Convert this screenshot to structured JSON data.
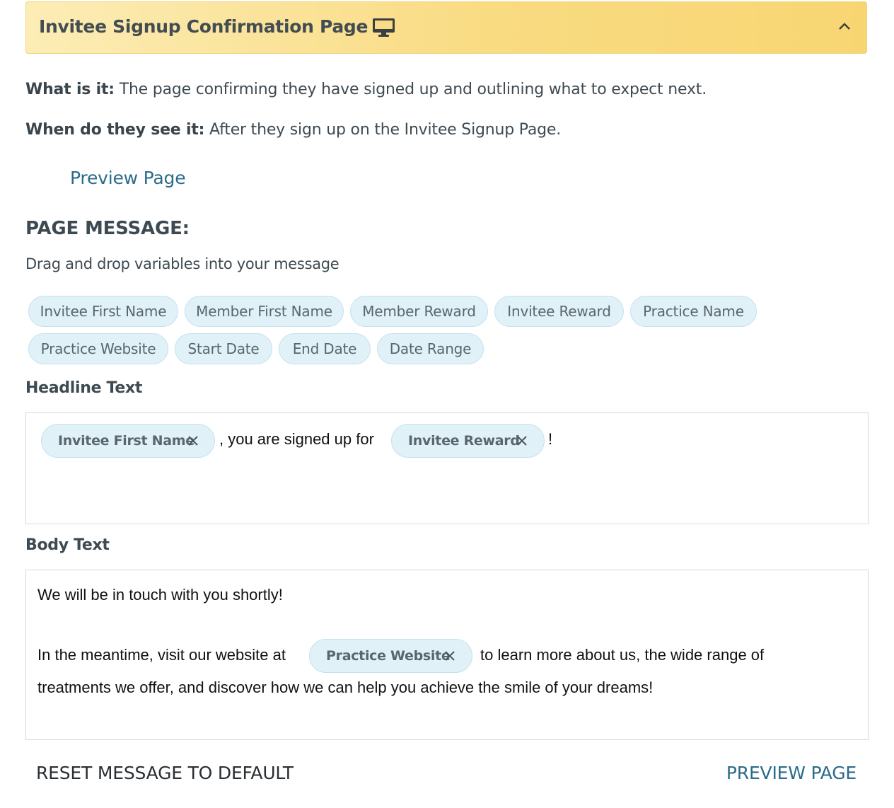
{
  "header": {
    "title": "Invitee Signup Confirmation Page",
    "device_icon": "desktop-monitor-icon",
    "collapse_icon": "chevron-up-icon"
  },
  "info": {
    "what_label": "What is it:",
    "what_text": " The page confirming they have signed up and outlining what to expect next.",
    "when_label": "When do they see it:",
    "when_text": " After they sign up on the Invitee Signup Page."
  },
  "preview_link": "Preview Page",
  "page_message": {
    "title": "PAGE MESSAGE:",
    "subtitle": "Drag and drop variables into your message",
    "variables": [
      "Invitee First Name",
      "Member First Name",
      "Member Reward",
      "Invitee Reward",
      "Practice Name",
      "Practice Website",
      "Start Date",
      "End Date",
      "Date Range"
    ]
  },
  "headline": {
    "label": "Headline Text",
    "token1": "Invitee First Name",
    "text1": ", you are signed up for",
    "token2": "Invitee Reward",
    "text2": "!"
  },
  "body": {
    "label": "Body Text",
    "line1": "We will be in touch with you shortly!",
    "line2_before": "In the meantime, visit our website at",
    "token": "Practice Website",
    "line2_after": "to learn more about us, the wide range of",
    "line3": "treatments we offer, and discover how we can help you achieve the smile of your dreams!"
  },
  "footer": {
    "reset_label": "RESET MESSAGE TO DEFAULT",
    "preview_label": "PREVIEW PAGE"
  },
  "colors": {
    "header_gradient_start": "#fcedb6",
    "header_gradient_end": "#f7d672",
    "link": "#2b6b8a",
    "chip_bg": "#e1f1f8"
  }
}
